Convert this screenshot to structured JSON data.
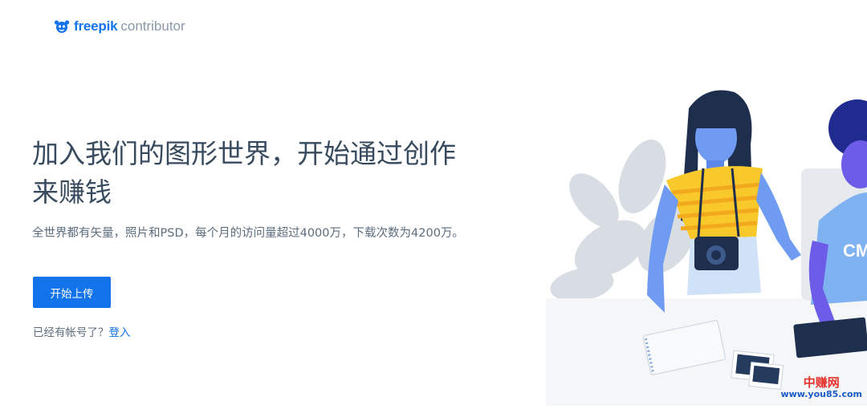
{
  "header": {
    "logo_brand": "freepik",
    "logo_sub": "contributor",
    "logo_icon": "freepik-mascot-icon"
  },
  "hero": {
    "title": "加入我们的图形世界，开始通过创作来赚钱",
    "description": "全世界都有矢量，照片和PSD，每个月的访问量超过4000万，下载次数为4200万。",
    "cta_label": "开始上传",
    "login_prompt": "已经有帐号了？",
    "login_link": "登入"
  },
  "illustration": {
    "shirt_text": "CM"
  },
  "watermark": {
    "line1": "中赚网",
    "line2": "www.you85.com"
  },
  "colors": {
    "brand": "#1273eb",
    "text": "#374a5e",
    "muted": "#8a99a8"
  }
}
